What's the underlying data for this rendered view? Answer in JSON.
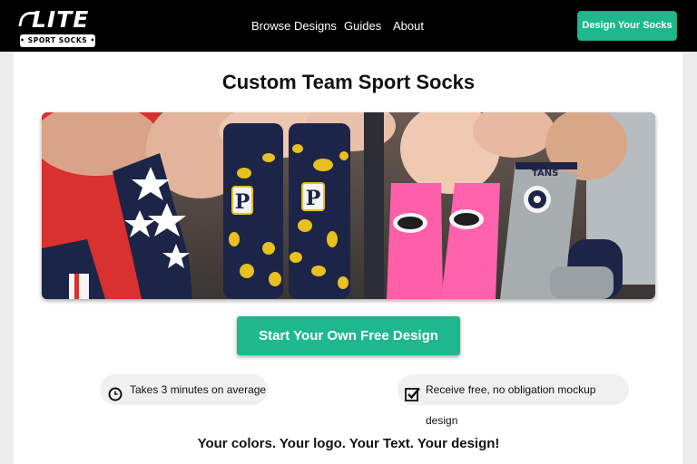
{
  "brand": {
    "logo_word": "LITE",
    "logo_tagline": "• SPORT SOCKS •"
  },
  "nav": {
    "browse": "Browse Designs",
    "guides": "Guides",
    "about": "About"
  },
  "header_cta": "Design Your Socks",
  "main": {
    "headline": "Custom Team Sport Socks",
    "cta": "Start Your Own Free Design",
    "features": [
      {
        "text": "Takes 3 minutes on average",
        "icon": "clock-icon"
      },
      {
        "text": "Receive free, no obligation mockup design",
        "icon": "checkbox-icon"
      }
    ],
    "tagline": "Your colors. Your logo. Your Text. Your design!"
  },
  "hero": {
    "sock_text": "TANS",
    "sock_letter": "P"
  },
  "colors": {
    "accent": "#1db88d",
    "navbar": "#000000",
    "navy": "#1c2447",
    "yellow": "#e8c020",
    "pink": "#ff5fa8",
    "gray_sock": "#a8aeb0"
  }
}
